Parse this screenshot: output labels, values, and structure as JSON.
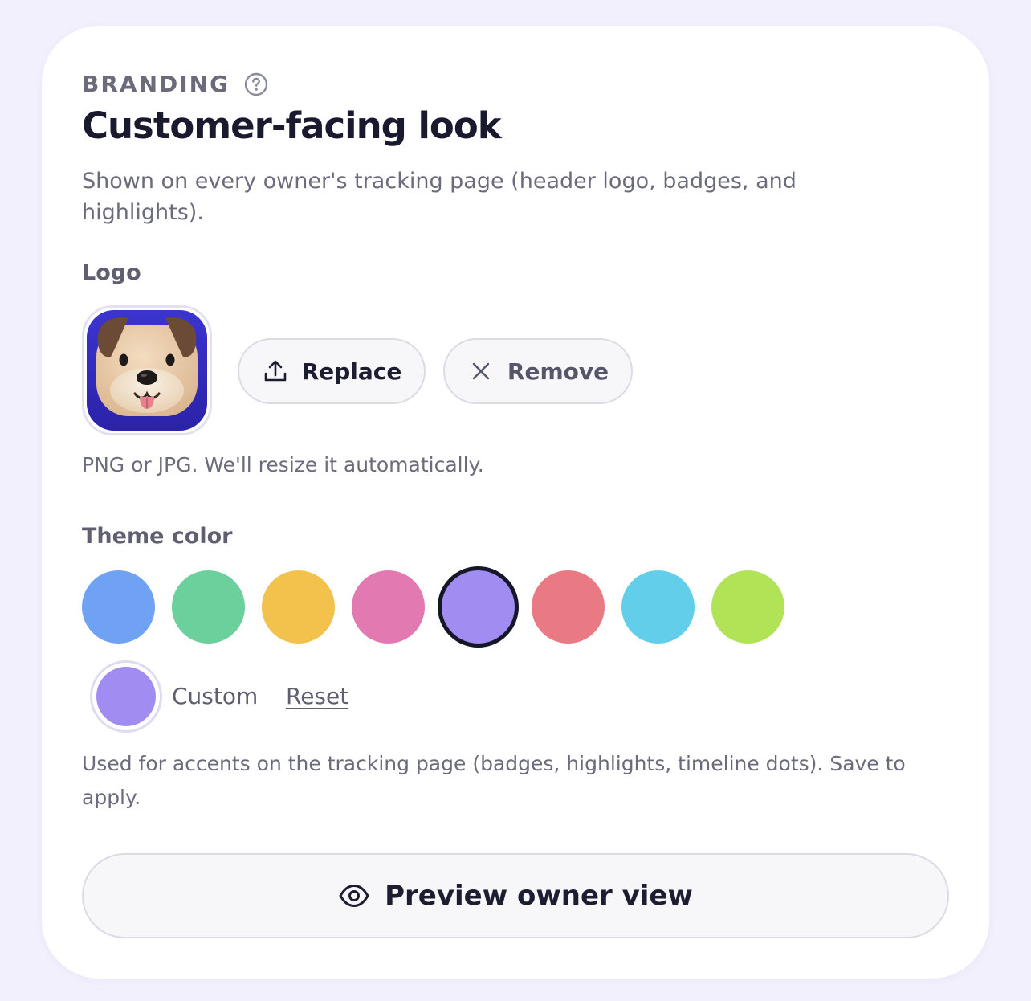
{
  "section": {
    "eyebrow": "BRANDING",
    "title": "Customer-facing look",
    "description": "Shown on every owner's tracking page (header logo, badges, and highlights)."
  },
  "logo": {
    "label": "Logo",
    "image_icon": "dog-mascot-icon",
    "replace_label": "Replace",
    "remove_label": "Remove",
    "hint": "PNG or JPG. We'll resize it automatically."
  },
  "theme": {
    "label": "Theme color",
    "swatches": [
      {
        "name": "blue",
        "color": "#6fa2f2"
      },
      {
        "name": "green",
        "color": "#6bd09b"
      },
      {
        "name": "yellow",
        "color": "#f2c24d"
      },
      {
        "name": "pink",
        "color": "#e27ab1"
      },
      {
        "name": "purple",
        "color": "#a18cf1",
        "selected": true
      },
      {
        "name": "red",
        "color": "#e97a84"
      },
      {
        "name": "cyan",
        "color": "#63cee9"
      },
      {
        "name": "lime",
        "color": "#b1e356"
      }
    ],
    "custom_label": "Custom",
    "custom_color": "#a18cf1",
    "reset_label": "Reset",
    "hint": "Used for accents on the tracking page (badges, highlights, timeline dots). Save to apply."
  },
  "preview": {
    "label": "Preview owner view",
    "icon": "eye-icon"
  }
}
